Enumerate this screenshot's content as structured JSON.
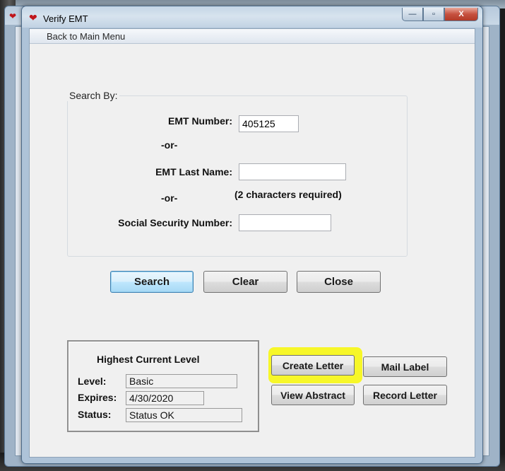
{
  "window": {
    "title": "Verify EMT",
    "minimize_glyph": "—",
    "maximize_glyph": "▫",
    "close_glyph": "X"
  },
  "menu": {
    "back": "Back to Main Menu"
  },
  "search": {
    "group_label": "Search By:",
    "emt_number_label": "EMT Number:",
    "emt_number_value": "405125",
    "or_1": "-or-",
    "last_name_label": "EMT Last Name:",
    "last_name_value": "",
    "last_name_hint": "(2 characters required)",
    "or_2": "-or-",
    "ssn_label": "Social Security Number:",
    "ssn_value": ""
  },
  "buttons": {
    "search": "Search",
    "clear": "Clear",
    "close": "Close",
    "create_letter": "Create Letter",
    "mail_label": "Mail Label",
    "view_abstract": "View Abstract",
    "record_letter": "Record Letter"
  },
  "level": {
    "heading": "Highest Current Level",
    "level_label": "Level:",
    "level_value": "Basic",
    "expires_label": "Expires:",
    "expires_value": "4/30/2020",
    "status_label": "Status:",
    "status_value": "Status OK"
  },
  "colors": {
    "highlight": "#f7f729",
    "default_button_border": "#3c7fb1",
    "app_icon": "#c0161b"
  }
}
